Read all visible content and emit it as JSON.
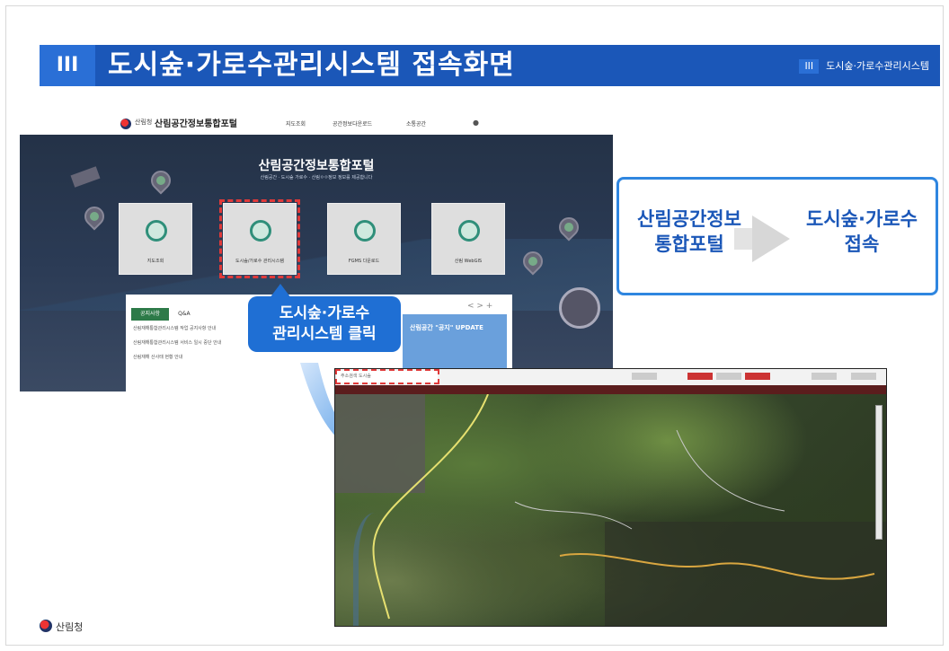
{
  "header": {
    "number": "III",
    "title": "도시숲·가로수관리시스템 접속화면",
    "crumb_tag": "III",
    "crumb_text": "도시숲·가로수관리시스템"
  },
  "portal": {
    "agency": "산림청",
    "name": "산림공간정보통합포털",
    "menu": [
      "지도조회",
      "공간정보다운로드",
      "소통공간"
    ],
    "heading": "산림공간정보통합포털",
    "subheading": "산림공간 · 도시숲 가로수 · 산림ㅇㅇ정보 정보를 제공합니다",
    "tiles": [
      {
        "label": "지도조회",
        "selected": false
      },
      {
        "label": "도시숲/가로수 관리시스템",
        "selected": true
      },
      {
        "label": "FGMS 다운로드",
        "selected": false
      },
      {
        "label": "산림 WebGIS",
        "selected": false
      }
    ],
    "notice_tabs": [
      "공지사항",
      "Q&A"
    ],
    "notice_lines": [
      "산림재해통합관리시스템 작업 공지사항 안내",
      "산림재해통합관리시스템 서비스 일시 중단 안내",
      "산림재해 산사태 현황 안내"
    ],
    "banner": "산림공간 \"공지\" UPDATE",
    "pager": "< > +"
  },
  "callout": {
    "line1": "도시숲·가로수",
    "line2": "관리시스템 클릭"
  },
  "flow": {
    "from_line1": "산림공간정보",
    "from_line2": "통합포털",
    "to_line1": "도시숲·가로수",
    "to_line2": "접속"
  },
  "map": {
    "search_text": "주소검색 도시숲"
  },
  "footer": {
    "agency": "산림청"
  },
  "colors": {
    "header_blue": "#1b57b8",
    "accent_blue": "#2f86e0",
    "highlight_red": "#e03a3a"
  }
}
